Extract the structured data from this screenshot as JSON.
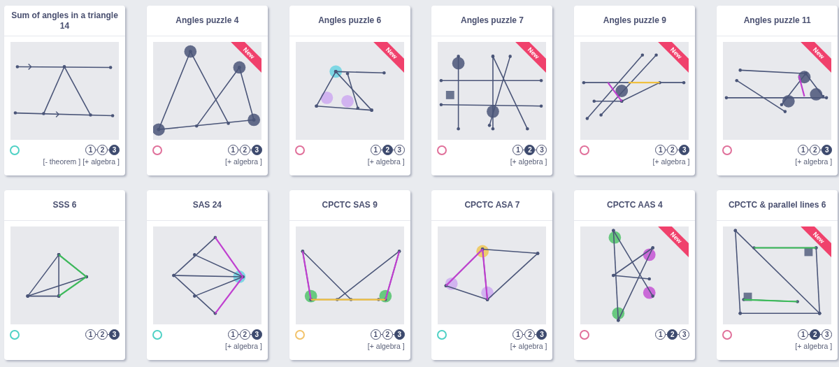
{
  "cards": [
    {
      "title": "Sum of angles in a triangle 14",
      "color": "#4fd1c5",
      "difficulty": [
        {
          "label": "1",
          "selected": false
        },
        {
          "label": "2",
          "selected": false
        },
        {
          "label": "3",
          "selected": true
        }
      ],
      "tags": [
        "[- theorem ]",
        "[+ algebra ]"
      ]
    },
    {
      "title": "Angles puzzle 4",
      "ribbon": "New",
      "color": "#e0709a",
      "difficulty": [
        {
          "label": "1",
          "selected": false
        },
        {
          "label": "2",
          "selected": false
        },
        {
          "label": "3",
          "selected": true
        }
      ],
      "tags": [
        "[+ algebra ]"
      ]
    },
    {
      "title": "Angles puzzle 6",
      "ribbon": "New",
      "color": "#e0709a",
      "difficulty": [
        {
          "label": "1",
          "selected": false
        },
        {
          "label": "2",
          "selected": true
        },
        {
          "label": "3",
          "selected": false
        }
      ],
      "tags": [
        "[+ algebra ]"
      ]
    },
    {
      "title": "Angles puzzle 7",
      "ribbon": "New",
      "color": "#e0709a",
      "difficulty": [
        {
          "label": "1",
          "selected": false
        },
        {
          "label": "2",
          "selected": true
        },
        {
          "label": "3",
          "selected": false
        }
      ],
      "tags": [
        "[+ algebra ]"
      ]
    },
    {
      "title": "Angles puzzle 9",
      "ribbon": "New",
      "color": "#e0709a",
      "difficulty": [
        {
          "label": "1",
          "selected": false
        },
        {
          "label": "2",
          "selected": false
        },
        {
          "label": "3",
          "selected": true
        }
      ],
      "tags": [
        "[+ algebra ]"
      ]
    },
    {
      "title": "Angles puzzle 11",
      "ribbon": "New",
      "color": "#e0709a",
      "difficulty": [
        {
          "label": "1",
          "selected": false
        },
        {
          "label": "2",
          "selected": false
        },
        {
          "label": "3",
          "selected": true
        }
      ],
      "tags": [
        "[+ algebra ]"
      ]
    },
    {
      "title": "SSS 6",
      "color": "#4fd1c5",
      "difficulty": [
        {
          "label": "1",
          "selected": false
        },
        {
          "label": "2",
          "selected": false
        },
        {
          "label": "3",
          "selected": true
        }
      ]
    },
    {
      "title": "SAS 24",
      "color": "#4fd1c5",
      "difficulty": [
        {
          "label": "1",
          "selected": false
        },
        {
          "label": "2",
          "selected": false
        },
        {
          "label": "3",
          "selected": true
        }
      ],
      "tags": [
        "[+ algebra ]"
      ]
    },
    {
      "title": "CPCTC SAS 9",
      "color": "#f2c36b",
      "difficulty": [
        {
          "label": "1",
          "selected": false
        },
        {
          "label": "2",
          "selected": false
        },
        {
          "label": "3",
          "selected": true
        }
      ],
      "tags": [
        "[+ algebra ]"
      ]
    },
    {
      "title": "CPCTC ASA 7",
      "color": "#4fd1c5",
      "difficulty": [
        {
          "label": "1",
          "selected": false
        },
        {
          "label": "2",
          "selected": false
        },
        {
          "label": "3",
          "selected": true
        }
      ],
      "tags": [
        "[+ algebra ]"
      ]
    },
    {
      "title": "CPCTC AAS 4",
      "ribbon": "New",
      "color": "#e0709a",
      "difficulty": [
        {
          "label": "1",
          "selected": false
        },
        {
          "label": "2",
          "selected": true
        },
        {
          "label": "3",
          "selected": false
        }
      ]
    },
    {
      "title": "CPCTC & parallel lines 6",
      "ribbon": "New",
      "color": "#e0709a",
      "difficulty": [
        {
          "label": "1",
          "selected": false
        },
        {
          "label": "2",
          "selected": true
        },
        {
          "label": "3",
          "selected": false
        }
      ],
      "tags": [
        "[+ algebra ]"
      ]
    }
  ]
}
